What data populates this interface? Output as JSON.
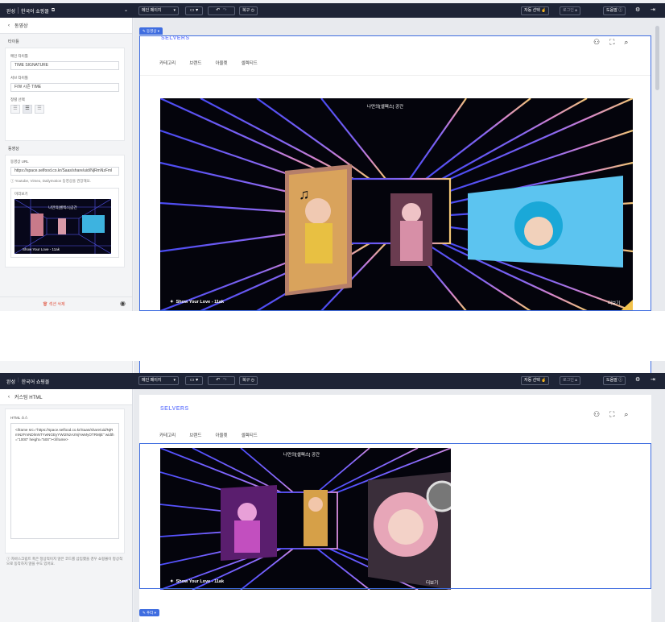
{
  "colors": {
    "topbar": "#1e2436",
    "accent": "#3f6de0",
    "brand": "#7c8cff",
    "delete": "#e0533f"
  },
  "topbar": {
    "app": "완성",
    "shop": "한국어 쇼핑몰",
    "ext_icon": "external-link-icon",
    "page_select": "메인 페이지",
    "device_icon": "monitor-icon",
    "undo_icon": "undo-icon",
    "redo_icon": "redo-icon",
    "restore": "복구",
    "auto_select": "자동 선택",
    "login": "로그인",
    "help": "도움말",
    "settings_icon": "gear-icon",
    "exit_icon": "exit-icon"
  },
  "site": {
    "brand": "SELVERS",
    "nav": [
      "카테고리",
      "브랜드",
      "아울렛",
      "셀렉티드"
    ]
  },
  "video": {
    "title": "나만의[셀렉스] 공간",
    "caption": "Show Your Love - 11ak",
    "more": "더보기"
  },
  "panel1": {
    "back_label": "동영상",
    "title_section": "타이틀",
    "main_title_label": "메인 타이틀",
    "main_title_value": "TIME SIGNATURE",
    "sub_title_label": "서브 타이틀",
    "sub_title_value": "F/W 시즌 TIME",
    "align_label": "정렬 선택",
    "video_section": "동영상",
    "url_label": "동영상 URL",
    "url_value": "https://space.selfood.co.kr/Saas/share/uid/NjRmNzFml",
    "url_note": "Youtube, Vimeo, Dailymotion 동영상을 권장해요.",
    "preview_label": "미리보기",
    "delete": "섹션 삭제",
    "selected_tag": "동영상"
  },
  "panel2": {
    "back_label": "커스텀 HTML",
    "html_label": "HTML 소스",
    "html_value": "<iframe src=\"https://space.selfood.co.kr/Saas/share/uid/NjRmNzFmNDlmNTYwNGEyYWI2NzAzNjYwMyOTRMjE\" width=\"1000\" height=\"500\"></iframe>",
    "note": "자바스크립트 혹은 정상적이지 않은 코드를 삽입했을 경우 쇼핑몰이 정상적으로 동작하지 않을 수도 있어요.",
    "footer_tag": "푸터"
  }
}
